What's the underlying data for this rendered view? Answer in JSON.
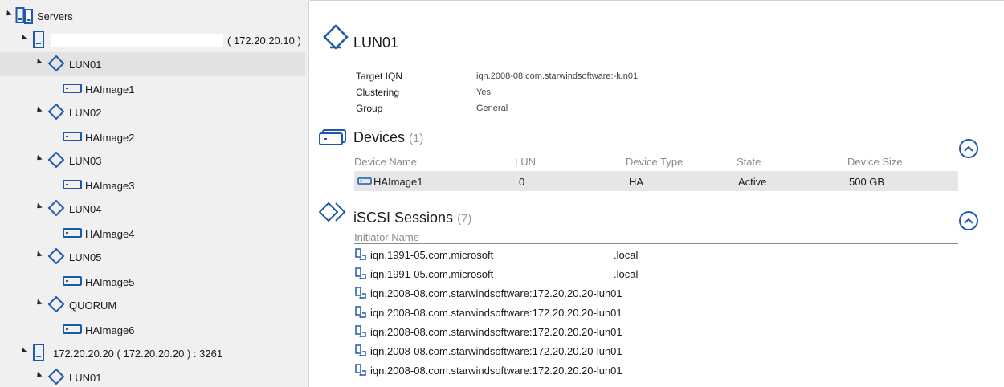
{
  "tree": {
    "root_label": "Servers",
    "server1": {
      "address": "( 172.20.20.10 )"
    },
    "server2": {
      "label": "172.20.20.20 ( 172.20.20.20 ) : 3261"
    },
    "targets": [
      {
        "label": "LUN01",
        "image": "HAImage1"
      },
      {
        "label": "LUN02",
        "image": "HAImage2"
      },
      {
        "label": "LUN03",
        "image": "HAImage3"
      },
      {
        "label": "LUN04",
        "image": "HAImage4"
      },
      {
        "label": "LUN05",
        "image": "HAImage5"
      },
      {
        "label": "QUORUM",
        "image": "HAImage6"
      }
    ],
    "server2_target": "LUN01"
  },
  "detail": {
    "title": "LUN01",
    "properties": [
      {
        "key": "Target IQN",
        "value": "iqn.2008-08.com.starwindsoftware:-lun01"
      },
      {
        "key": "Clustering",
        "value": "Yes"
      },
      {
        "key": "Group",
        "value": "General"
      }
    ],
    "devices": {
      "title": "Devices",
      "count": "(1)",
      "columns": [
        "Device Name",
        "LUN",
        "Device Type",
        "State",
        "Device Size"
      ],
      "rows": [
        {
          "name": "HAImage1",
          "lun": "0",
          "type": "HA",
          "state": "Active",
          "size": "500 GB"
        }
      ]
    },
    "sessions": {
      "title": "iSCSI Sessions",
      "count": "(7)",
      "column": "Initiator Name",
      "items": [
        {
          "name": "iqn.1991-05.com.microsoft",
          "suffix": ".local"
        },
        {
          "name": "iqn.1991-05.com.microsoft",
          "suffix": ".local"
        },
        {
          "name": "iqn.2008-08.com.starwindsoftware:172.20.20.20-lun01",
          "suffix": ""
        },
        {
          "name": "iqn.2008-08.com.starwindsoftware:172.20.20.20-lun01",
          "suffix": ""
        },
        {
          "name": "iqn.2008-08.com.starwindsoftware:172.20.20.20-lun01",
          "suffix": ""
        },
        {
          "name": "iqn.2008-08.com.starwindsoftware:172.20.20.20-lun01",
          "suffix": ""
        },
        {
          "name": "iqn.2008-08.com.starwindsoftware:172.20.20.20-lun01",
          "suffix": ""
        }
      ]
    }
  },
  "colors": {
    "accent": "#1e5aa8",
    "tree_bg": "#f0f0f0",
    "selected_bg": "#e2e2e2",
    "row_bg": "#e6e6e6"
  },
  "icons": {
    "servers": "servers-group-icon",
    "server": "server-icon",
    "target": "target-diamond-icon",
    "image": "disk-image-icon",
    "devices": "devices-icon",
    "sessions": "iscsi-sessions-icon",
    "session": "session-link-icon",
    "collapse": "chevron-up-icon"
  }
}
